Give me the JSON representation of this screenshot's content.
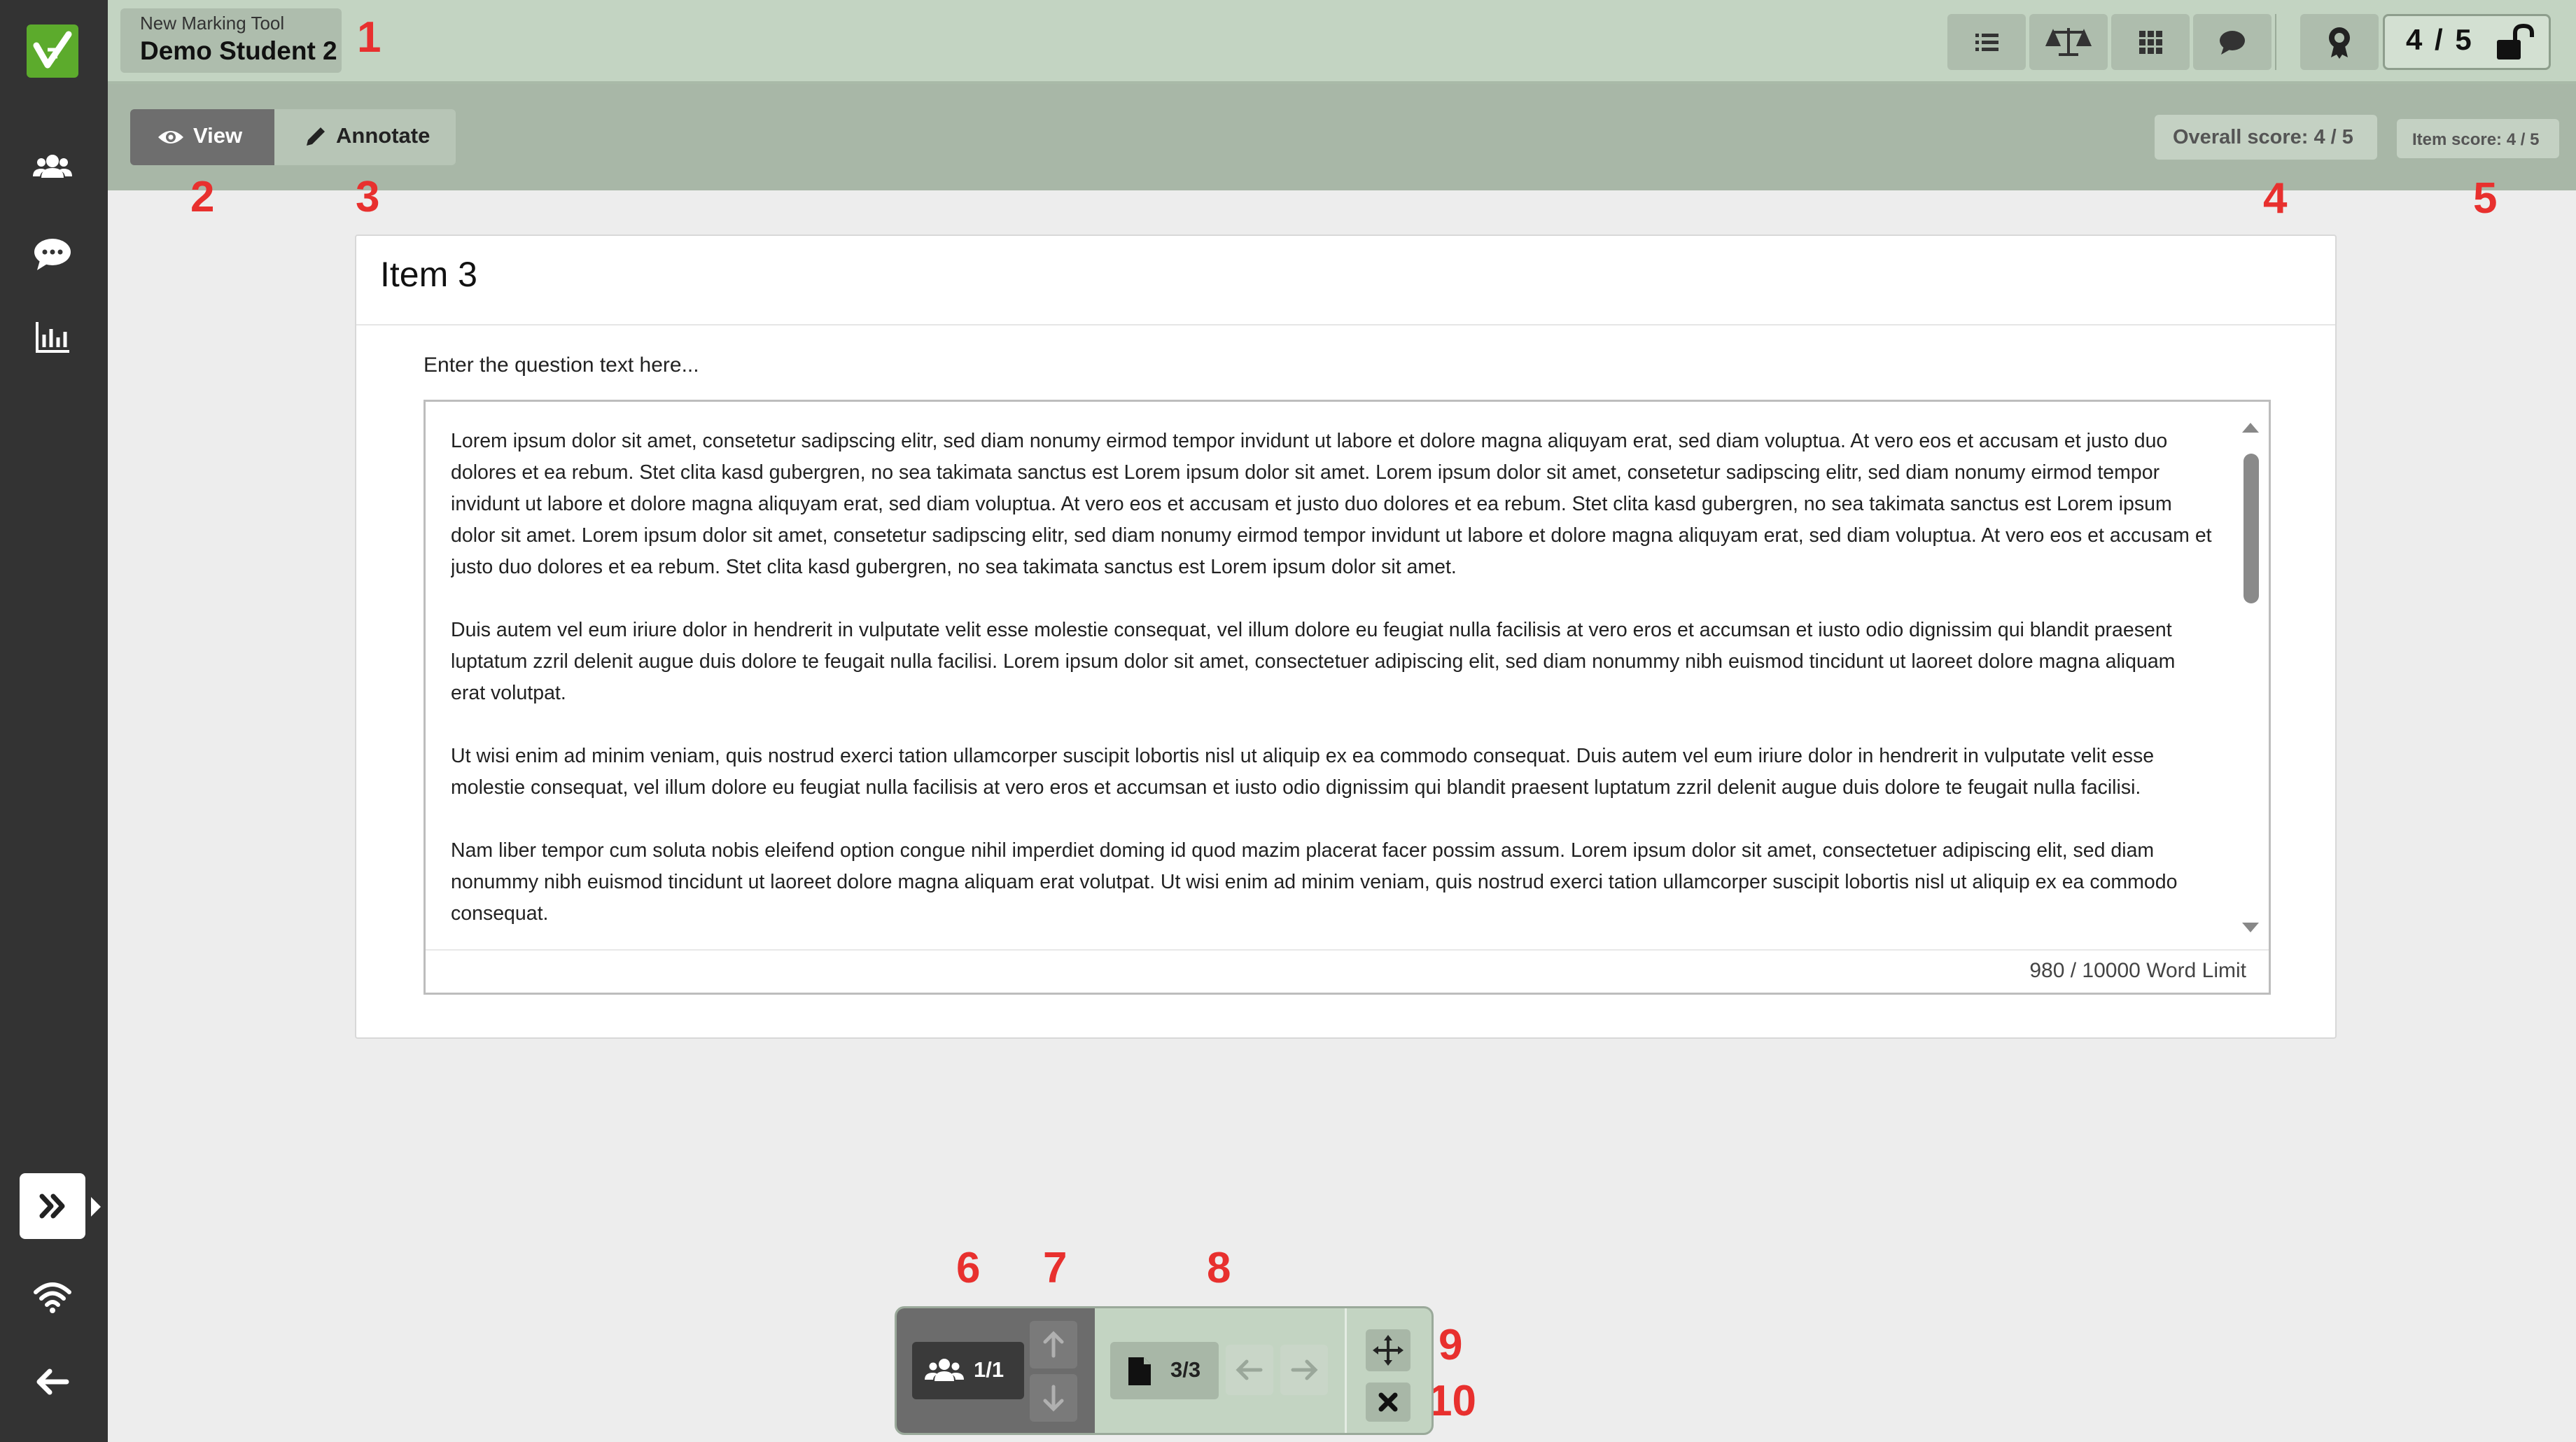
{
  "sidebar": {
    "icons": [
      "logo-icon",
      "users-icon",
      "comments-icon",
      "chart-icon",
      "expand-icon",
      "wifi-icon",
      "back-arrow-icon"
    ]
  },
  "header": {
    "tool_name": "New Marking Tool",
    "student_name": "Demo Student 2",
    "buttons": [
      "list-icon",
      "scale-icon",
      "grid-icon",
      "comment-icon",
      "award-icon"
    ],
    "score": "4 / 5"
  },
  "subbar": {
    "view_label": "View",
    "annotate_label": "Annotate",
    "overall_score": "Overall score: 4 / 5",
    "item_score": "Item score: 4 / 5"
  },
  "item": {
    "title": "Item 3",
    "question": "Enter the question text here...",
    "paragraphs": [
      "Lorem ipsum dolor sit amet, consetetur sadipscing elitr, sed diam nonumy eirmod tempor invidunt ut labore et dolore magna aliquyam erat, sed diam voluptua. At vero eos et accusam et justo duo dolores et ea rebum. Stet clita kasd gubergren, no sea takimata sanctus est Lorem ipsum dolor sit amet. Lorem ipsum dolor sit amet, consetetur sadipscing elitr, sed diam nonumy eirmod tempor invidunt ut labore et dolore magna aliquyam erat, sed diam voluptua. At vero eos et accusam et justo duo dolores et ea rebum. Stet clita kasd gubergren, no sea takimata sanctus est Lorem ipsum dolor sit amet. Lorem ipsum dolor sit amet, consetetur sadipscing elitr, sed diam nonumy eirmod tempor invidunt ut labore et dolore magna aliquyam erat, sed diam voluptua. At vero eos et accusam et justo duo dolores et ea rebum. Stet clita kasd gubergren, no sea takimata sanctus est Lorem ipsum dolor sit amet.",
      "Duis autem vel eum iriure dolor in hendrerit in vulputate velit esse molestie consequat, vel illum dolore eu feugiat nulla facilisis at vero eros et accumsan et iusto odio dignissim qui blandit praesent luptatum zzril delenit augue duis dolore te feugait nulla facilisi. Lorem ipsum dolor sit amet, consectetuer adipiscing elit, sed diam nonummy nibh euismod tincidunt ut laoreet dolore magna aliquam erat volutpat.",
      "Ut wisi enim ad minim veniam, quis nostrud exerci tation ullamcorper suscipit lobortis nisl ut aliquip ex ea commodo consequat. Duis autem vel eum iriure dolor in hendrerit in vulputate velit esse molestie consequat, vel illum dolore eu feugiat nulla facilisis at vero eros et accumsan et iusto odio dignissim qui blandit praesent luptatum zzril delenit augue duis dolore te feugait nulla facilisi.",
      "Nam liber tempor cum soluta nobis eleifend option congue nihil imperdiet doming id quod mazim placerat facer possim assum. Lorem ipsum dolor sit amet, consectetuer adipiscing elit, sed diam nonummy nibh euismod tincidunt ut laoreet dolore magna aliquam erat volutpat. Ut wisi enim ad minim veniam, quis nostrud exerci tation ullamcorper suscipit lobortis nisl ut aliquip ex ea commodo consequat."
    ],
    "word_count": "980  / 10000 Word Limit"
  },
  "markers": [
    "1",
    "2",
    "3",
    "4",
    "5",
    "6",
    "7",
    "8",
    "9",
    "10"
  ],
  "bottombar": {
    "students": "1/1",
    "pages": "3/3"
  },
  "colors": {
    "sidebar": "#333333",
    "topbar": "#c3d4c2",
    "subbar": "#a8b7a7",
    "logo": "#5cab2c",
    "marker": "#e8302e"
  }
}
